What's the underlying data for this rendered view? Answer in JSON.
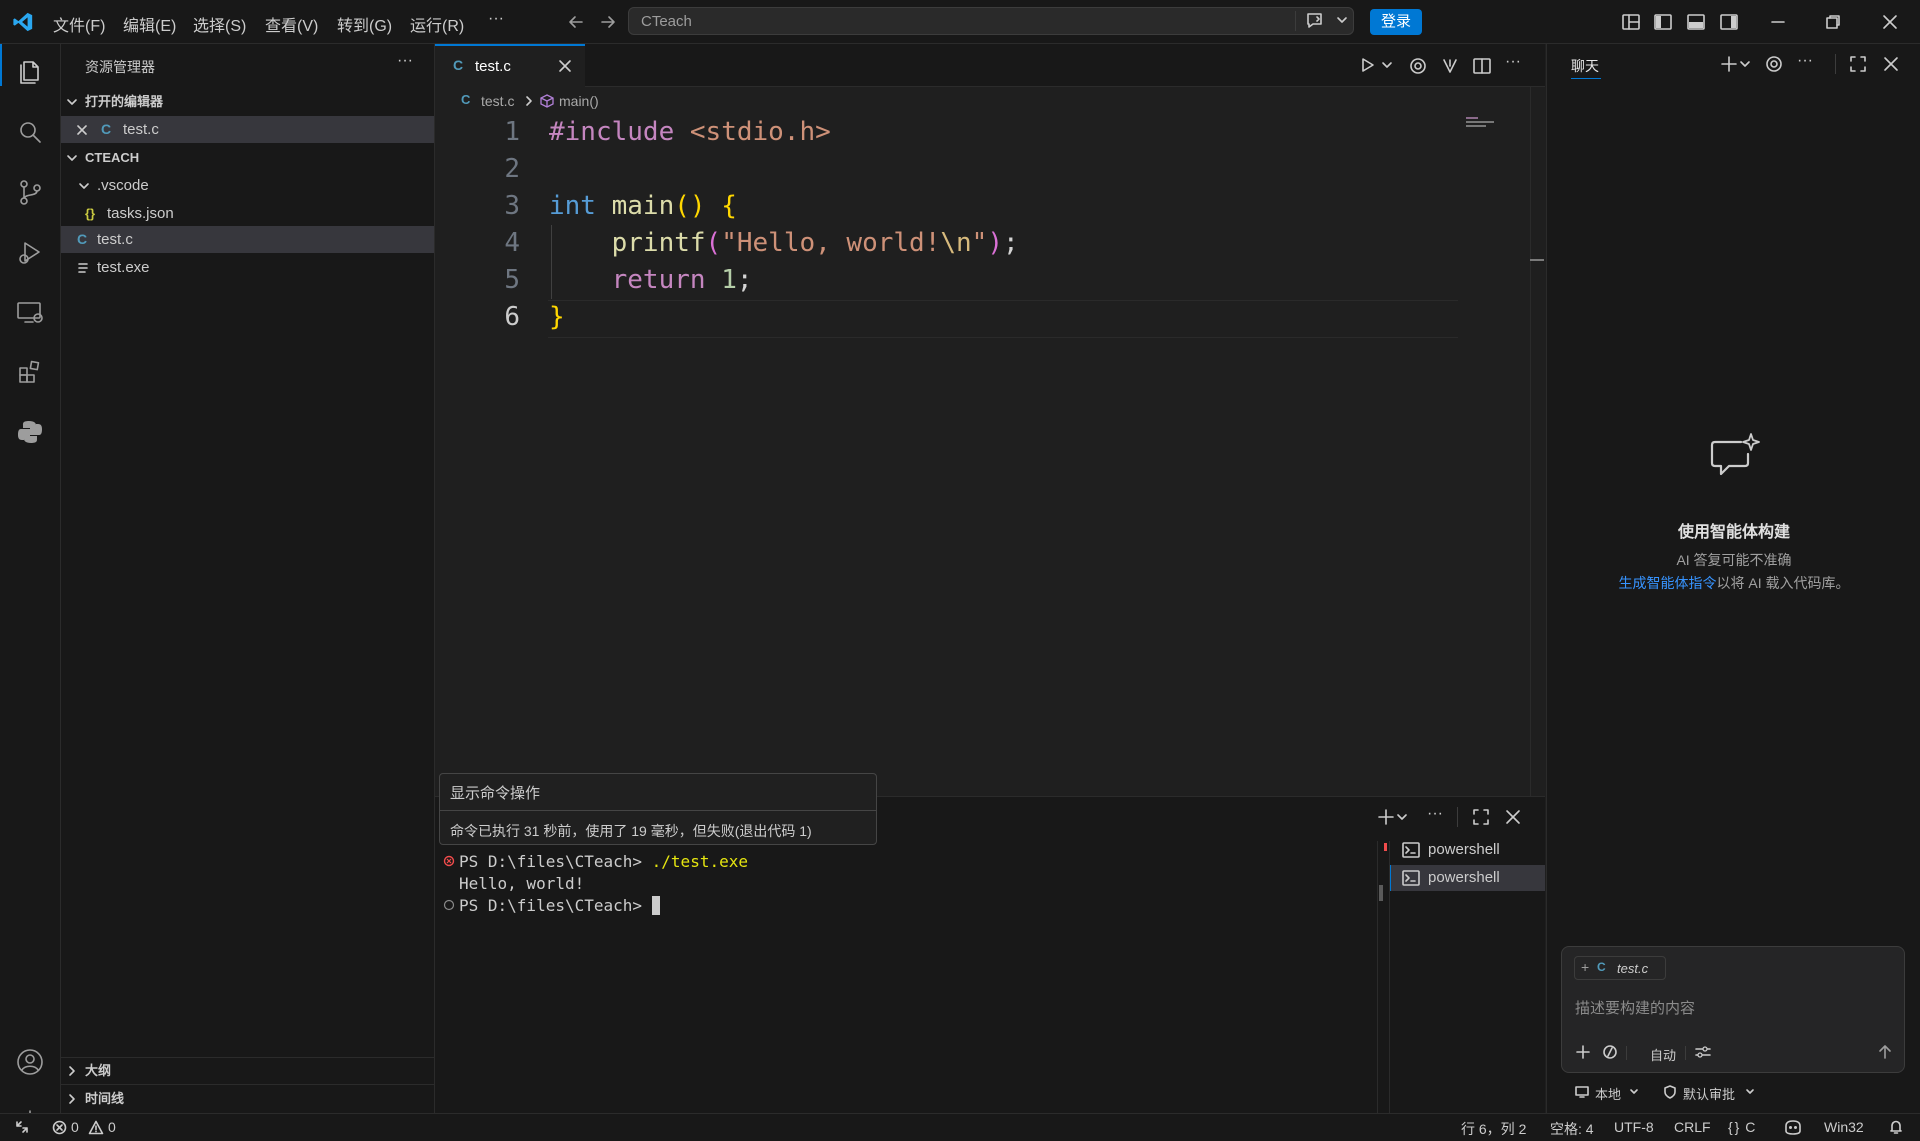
{
  "menu": [
    "文件(F)",
    "编辑(E)",
    "选择(S)",
    "查看(V)",
    "转到(G)",
    "运行(R)",
    "···"
  ],
  "command_center": {
    "placeholder": "CTeach"
  },
  "login_label": "登录",
  "sidebar": {
    "title": "资源管理器",
    "open_editors_header": "打开的编辑器",
    "open_editors": [
      {
        "icon": "C",
        "name": "test.c"
      }
    ],
    "project_header": "CTEACH",
    "tree": [
      {
        "name": ".vscode",
        "icon": "chevron-down-icon"
      },
      {
        "name": "tasks.json",
        "icon": "{}"
      },
      {
        "name": "test.c",
        "icon": "C"
      },
      {
        "name": "test.exe",
        "icon": "lines-icon"
      }
    ],
    "outline": "大纲",
    "timeline": "时间线"
  },
  "editor": {
    "tab": "test.c",
    "tab_icon": "C",
    "breadcrumb_file": "test.c",
    "breadcrumb_symbol": "main()",
    "line_numbers": [
      "1",
      "2",
      "3",
      "4",
      "5",
      "6"
    ],
    "code": {
      "l1_kw": "#include",
      "l1_rest": " <stdio.h>",
      "l3_type": "int",
      "l3_fn": " main",
      "l3_paren": "()",
      "l3_brace": " {",
      "l4_fn": "printf",
      "l4_open": "(",
      "l4_str1": "\"Hello, world!",
      "l4_esc": "\\n",
      "l4_str2": "\"",
      "l4_close": ")",
      "l4_semi": ";",
      "l5_kw": "return",
      "l5_num": " 1",
      "l5_semi": ";",
      "l6_brace": "}"
    }
  },
  "hover": {
    "title": "显示命令操作",
    "body": "命令已执行 31 秒前，使用了 19 毫秒，但失败(退出代码 1)"
  },
  "terminal": {
    "line1_prompt": "PS D:\\files\\CTeach> ",
    "line1_cmd": "./test.exe",
    "line2": "Hello, world!",
    "line3_prompt": "PS D:\\files\\CTeach> ",
    "sessions": [
      "powershell",
      "powershell"
    ]
  },
  "chat": {
    "tab": "聊天",
    "heading": "使用智能体构建",
    "sub": "AI 答复可能不准确",
    "link": "生成智能体指令",
    "link_rest": "以将 AI 载入代码库。",
    "context_file": "test.c",
    "input_placeholder": "描述要构建的内容",
    "mode": "自动",
    "footer_local": "本地",
    "footer_approve": "默认审批"
  },
  "status": {
    "errors": "0",
    "warnings": "0",
    "position": "行 6，列 2",
    "spaces": "空格: 4",
    "encoding": "UTF-8",
    "eol": "CRLF",
    "language": "C",
    "platform": "Win32"
  }
}
